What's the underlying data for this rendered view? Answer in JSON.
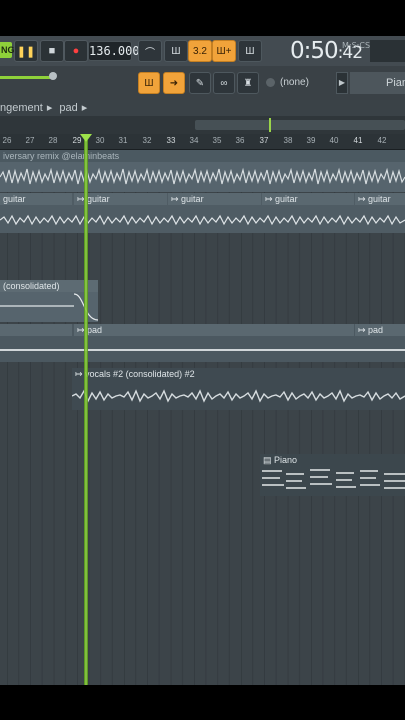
{
  "transport": {
    "pattern_label": "NG",
    "play_icon": "pause-icon",
    "stop_icon": "stop-icon",
    "record_icon": "record-icon",
    "tempo": "136.000",
    "snap_label": "3.2",
    "time_main": "0:50",
    "time_sub": "42",
    "time_unit": "M:S:CS",
    "channel_none": "(none)",
    "piano_label": "Piano"
  },
  "breadcrumb": {
    "items": [
      "ngement",
      "pad"
    ]
  },
  "ruler": {
    "ticks": [
      "26",
      "27",
      "28",
      "29",
      "30",
      "31",
      "32",
      "33",
      "34",
      "35",
      "36",
      "37",
      "38",
      "39",
      "40",
      "41",
      "42"
    ]
  },
  "tracks": {
    "master_clip": "iversary remix @elaminbeats",
    "guitar_clips": [
      "guitar",
      "guitar",
      "guitar",
      "guitar",
      "guitar"
    ],
    "consolidated_clip": "(consolidated)",
    "pad_clips": [
      "pad",
      "pad"
    ],
    "vocals_clip": "vocals #2 (consolidated) #2",
    "piano_clip": "Piano"
  },
  "colors": {
    "accent_green": "#9de24a",
    "accent_orange": "#f1a33a",
    "clip_blue": "#5d6f7a",
    "background": "#3a4247"
  }
}
